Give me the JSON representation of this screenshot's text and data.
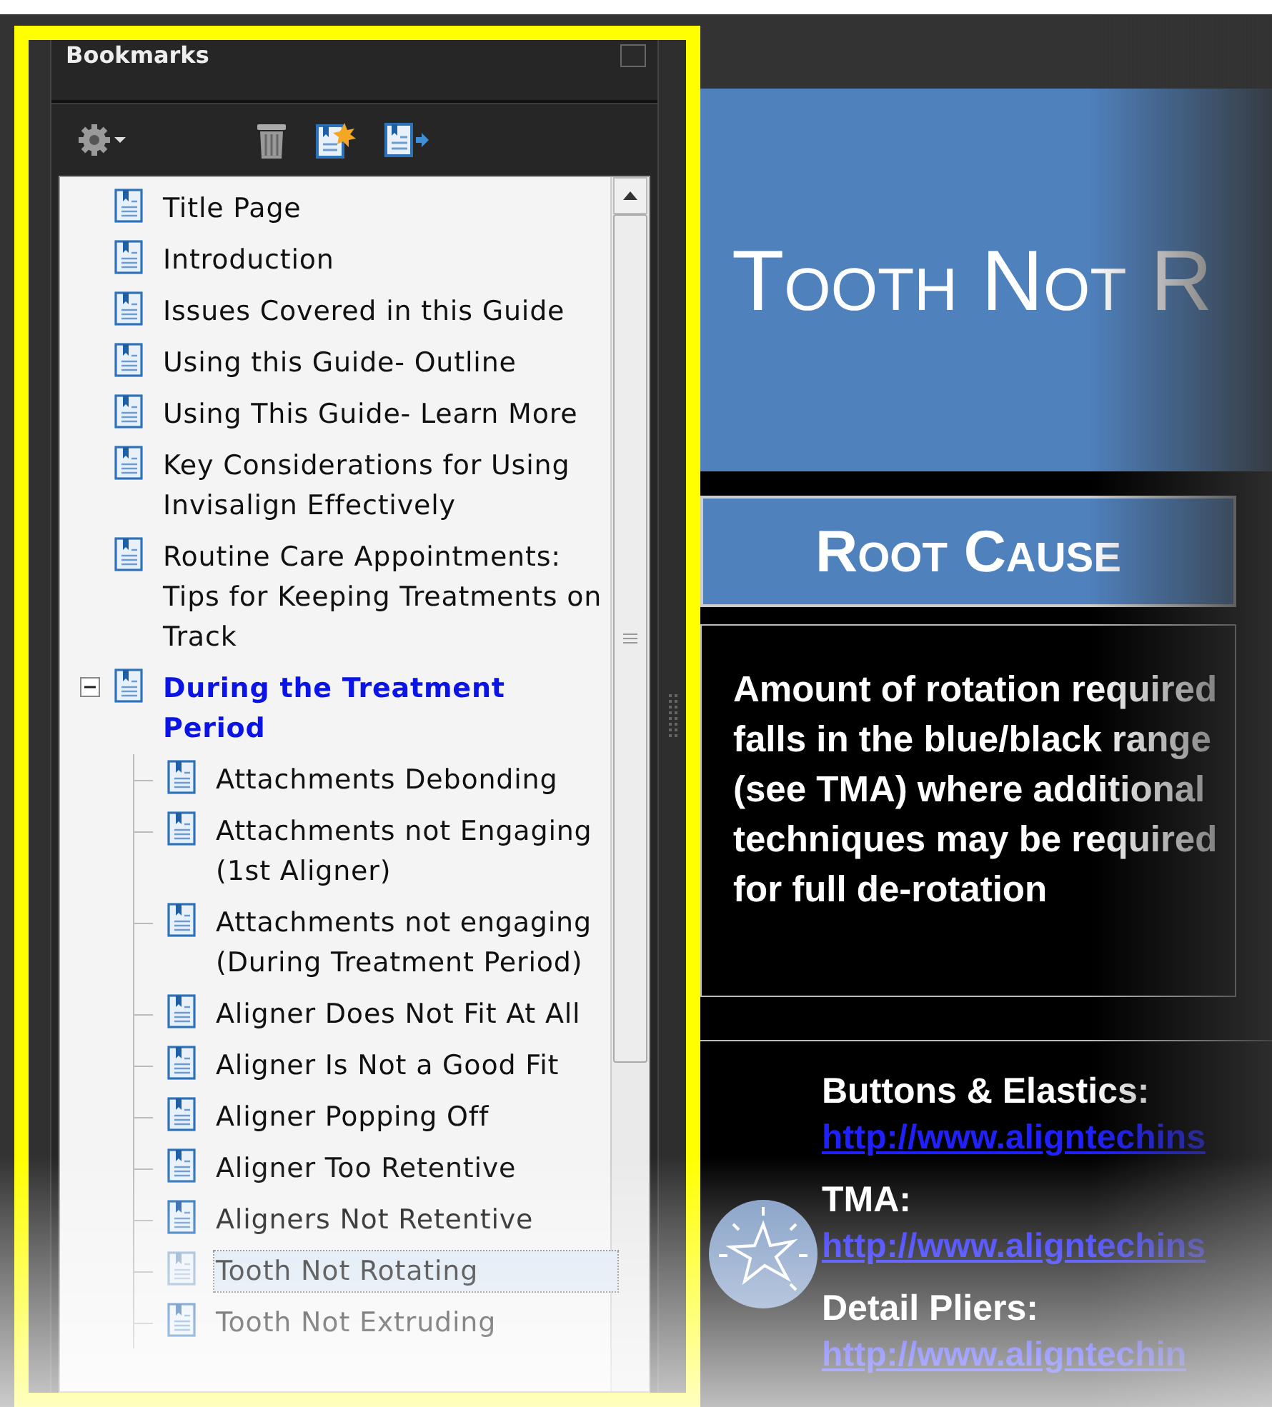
{
  "panel": {
    "title": "Bookmarks"
  },
  "bookmarks": [
    {
      "label": "Title Page",
      "selected": false,
      "emphasized": false
    },
    {
      "label": "Introduction",
      "selected": false,
      "emphasized": false
    },
    {
      "label": "Issues Covered in this Guide",
      "selected": false,
      "emphasized": false
    },
    {
      "label": "Using this Guide- Outline",
      "selected": false,
      "emphasized": false
    },
    {
      "label": "Using This Guide- Learn More",
      "selected": false,
      "emphasized": false
    },
    {
      "label": "Key Considerations for Using Invisalign Effectively",
      "selected": false,
      "emphasized": false
    },
    {
      "label": "Routine Care Appointments: Tips for Keeping Treatments on Track",
      "selected": false,
      "emphasized": false
    },
    {
      "label": "During the Treatment Period",
      "selected": false,
      "emphasized": true,
      "expanded": true,
      "children": [
        {
          "label": "Attachments Debonding",
          "selected": false,
          "emphasized": false
        },
        {
          "label": "Attachments not Engaging (1st Aligner)",
          "selected": false,
          "emphasized": false
        },
        {
          "label": "Attachments not engaging (During Treatment Period)",
          "selected": false,
          "emphasized": false
        },
        {
          "label": "Aligner Does Not Fit  At All",
          "selected": false,
          "emphasized": false
        },
        {
          "label": "Aligner Is Not a Good Fit",
          "selected": false,
          "emphasized": false
        },
        {
          "label": "Aligner Popping Off",
          "selected": false,
          "emphasized": false
        },
        {
          "label": "Aligner Too Retentive",
          "selected": false,
          "emphasized": false
        },
        {
          "label": "Aligners Not Retentive",
          "selected": false,
          "emphasized": false
        },
        {
          "label": "Tooth Not Rotating",
          "selected": true,
          "emphasized": false
        },
        {
          "label": "Tooth Not Extruding",
          "selected": false,
          "emphasized": false
        }
      ]
    }
  ],
  "document": {
    "title": "Tooth Not R",
    "section": "Root Cause",
    "cause": "Amount of rotation required falls in the blue/black range (see TMA) where additional techniques may be required for full de-rotation",
    "resources": [
      {
        "label": "Buttons & Elastics:",
        "link": "http://www.aligntechins"
      },
      {
        "label": "TMA:",
        "link": "http://www.aligntechins"
      },
      {
        "label": "Detail Pliers:",
        "link": "http://www.aligntechin"
      }
    ]
  }
}
